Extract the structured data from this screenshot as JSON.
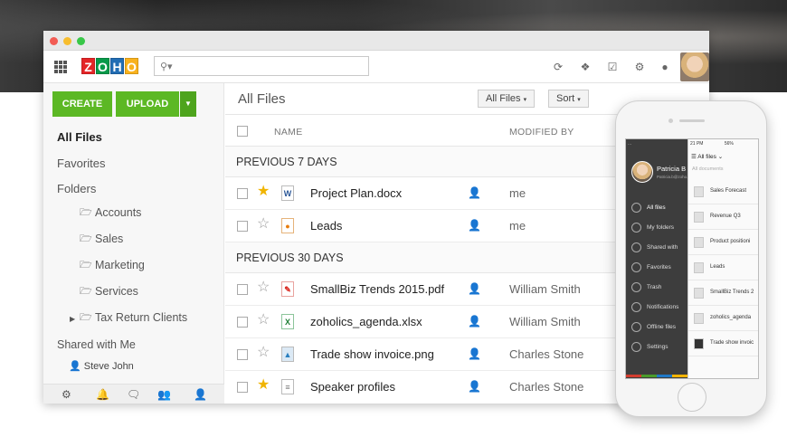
{
  "logo_letters": [
    "Z",
    "O",
    "H",
    "O"
  ],
  "logo_colors": [
    "#e42527",
    "#089949",
    "#226db4",
    "#f9b21d"
  ],
  "search": {
    "placeholder": ""
  },
  "sidebar": {
    "create_label": "CREATE",
    "upload_label": "UPLOAD",
    "nav": [
      "All Files",
      "Favorites",
      "Folders"
    ],
    "folders": [
      "Accounts",
      "Sales",
      "Marketing",
      "Services",
      "Tax Return Clients"
    ],
    "shared_label": "Shared with Me",
    "shared_user": "Steve John"
  },
  "main": {
    "title": "All Files",
    "filter_label": "All Files",
    "sort_label": "Sort",
    "columns": {
      "name": "NAME",
      "modified_by": "MODIFIED BY"
    },
    "sections": [
      "PREVIOUS 7 DAYS",
      "PREVIOUS 30 DAYS"
    ],
    "files": [
      {
        "name": "Project Plan.docx",
        "modified_by": "me",
        "starred": true,
        "type": "word"
      },
      {
        "name": "Leads",
        "modified_by": "me",
        "starred": false,
        "type": "sheet-shared"
      },
      {
        "name": "SmallBiz Trends 2015.pdf",
        "modified_by": "William Smith",
        "starred": false,
        "type": "pdf"
      },
      {
        "name": "zoholics_agenda.xlsx",
        "modified_by": "William Smith",
        "starred": false,
        "type": "excel"
      },
      {
        "name": "Trade show invoice.png",
        "modified_by": "Charles Stone",
        "starred": false,
        "type": "image"
      },
      {
        "name": "Speaker profiles",
        "modified_by": "Charles Stone",
        "starred": true,
        "type": "doc"
      }
    ]
  },
  "phone": {
    "status_left": "...",
    "status_right": "21 PM",
    "status_battery": "56%",
    "user_name": "Patricia B",
    "user_email": "Patricia.b@zoho...",
    "drawer_items": [
      "All files",
      "My folders",
      "Shared with",
      "Favorites",
      "Trash",
      "Notifications",
      "Offline files",
      "Settings"
    ],
    "list_title": "All files",
    "list_search": "All documents",
    "list_items": [
      "Sales Forecast",
      "Revenue Q3",
      "Product positioni",
      "Leads",
      "SmallBiz Trends 2",
      "zoholics_agenda",
      "Trade show invoic"
    ]
  },
  "colors": {
    "accent_green": "#5cb824",
    "star_gold": "#f0b400"
  }
}
